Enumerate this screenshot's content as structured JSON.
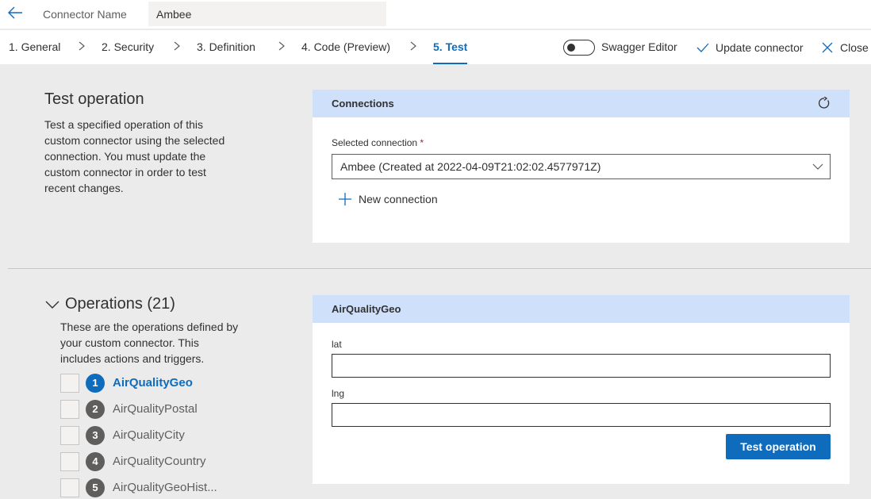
{
  "header": {
    "connector_name_label": "Connector Name",
    "connector_name_value": "Ambee"
  },
  "tabs": [
    {
      "label": "1. General"
    },
    {
      "label": "2. Security"
    },
    {
      "label": "3. Definition"
    },
    {
      "label": "4. Code (Preview)"
    },
    {
      "label": "5. Test",
      "active": true
    }
  ],
  "toolbar": {
    "swagger_label": "Swagger Editor",
    "swagger_enabled": false,
    "update_label": "Update connector",
    "close_label": "Close"
  },
  "test_section": {
    "title": "Test operation",
    "description": "Test a specified operation of this custom connector using the selected connection. You must update the custom connector in order to test recent changes."
  },
  "connections": {
    "header": "Connections",
    "field_label": "Selected connection",
    "required_mark": "*",
    "selected_value": "Ambee (Created at 2022-04-09T21:02:02.4577971Z)",
    "new_connection_label": "New connection"
  },
  "operations": {
    "title": "Operations (21)",
    "description": "These are the operations defined by your custom connector. This includes actions and triggers.",
    "items": [
      {
        "num": "1",
        "name": "AirQualityGeo",
        "active": true
      },
      {
        "num": "2",
        "name": "AirQualityPostal"
      },
      {
        "num": "3",
        "name": "AirQualityCity"
      },
      {
        "num": "4",
        "name": "AirQualityCountry"
      },
      {
        "num": "5",
        "name": "AirQualityGeoHist..."
      }
    ]
  },
  "operation_panel": {
    "header": "AirQualityGeo",
    "lat_label": "lat",
    "lat_value": "",
    "lng_label": "lng",
    "lng_value": "",
    "test_button": "Test operation"
  },
  "colors": {
    "accent": "#0f6cbd",
    "card_header": "#cfe0fb",
    "background": "#ebebeb"
  }
}
